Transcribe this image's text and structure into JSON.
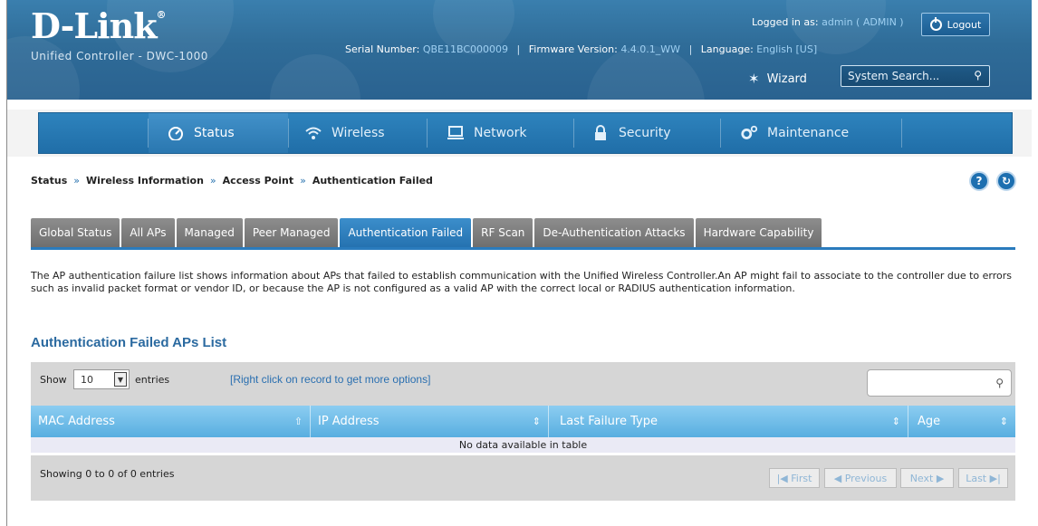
{
  "header": {
    "brand": "D-Link",
    "reg_mark": "®",
    "subtitle": "Unified Controller - DWC-1000",
    "logged_in_label": "Logged in as:",
    "logged_in_value": "admin ( ADMIN )",
    "logout_label": "Logout",
    "serial_label": "Serial Number:",
    "serial_value": "QBE11BC000009",
    "firmware_label": "Firmware Version:",
    "firmware_value": "4.4.0.1_WW",
    "language_label": "Language:",
    "language_value": "English [US]",
    "wizard_label": "Wizard",
    "search_placeholder": "System Search..."
  },
  "nav": {
    "items": [
      {
        "label": "Status",
        "icon": "gauge-icon",
        "active": true
      },
      {
        "label": "Wireless",
        "icon": "wifi-icon",
        "active": false
      },
      {
        "label": "Network",
        "icon": "computer-icon",
        "active": false
      },
      {
        "label": "Security",
        "icon": "lock-icon",
        "active": false
      },
      {
        "label": "Maintenance",
        "icon": "gears-icon",
        "active": false
      }
    ]
  },
  "breadcrumb": [
    "Status",
    "Wireless Information",
    "Access Point",
    "Authentication Failed"
  ],
  "breadcrumb_sep": "»",
  "tabs": [
    "Global Status",
    "All APs",
    "Managed",
    "Peer Managed",
    "Authentication Failed",
    "RF Scan",
    "De-Authentication Attacks",
    "Hardware Capability"
  ],
  "active_tab": "Authentication Failed",
  "description": "The AP authentication failure list shows information about APs that failed to establish communication with the Unified Wireless Controller.An AP might fail to associate to the controller due to errors such as invalid packet format or vendor ID, or because the AP is not configured as a valid AP with the correct local or RADIUS authentication information.",
  "list_title": "Authentication Failed APs List",
  "table": {
    "show_label": "Show",
    "entries_value": "10",
    "entries_label": "entries",
    "hint": "[Right click on record to get more options]",
    "columns": [
      "MAC Address",
      "IP Address",
      "Last Failure Type",
      "Age"
    ],
    "empty_text": "No data available in table",
    "info": "Showing 0 to 0 of 0 entries",
    "pager": {
      "first": "First",
      "previous": "Previous",
      "next": "Next",
      "last": "Last"
    }
  },
  "colors": {
    "header_blue": "#2f6c98",
    "nav_blue": "#206ea8",
    "tab_active": "#2572b0",
    "tab_inactive": "#7d7d7d",
    "table_header": "#58aee0",
    "link_blue": "#2a6fb0"
  }
}
